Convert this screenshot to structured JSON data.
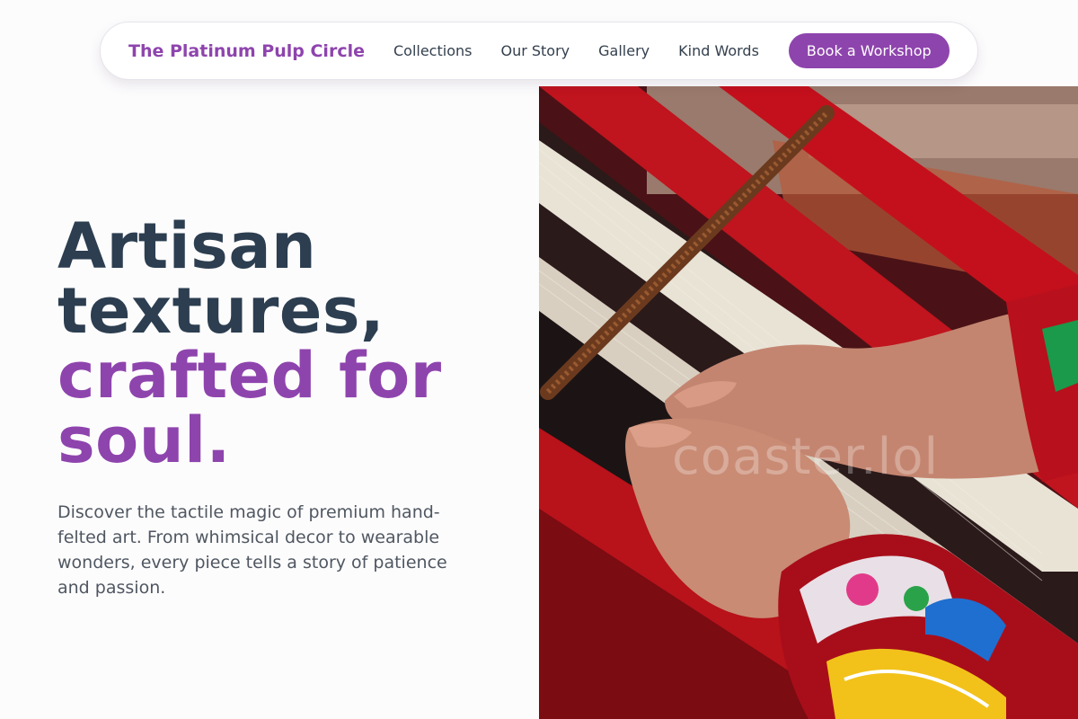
{
  "nav": {
    "brand": "The Platinum Pulp Circle",
    "links": [
      "Collections",
      "Our Story",
      "Gallery",
      "Kind Words"
    ],
    "cta": "Book a Workshop"
  },
  "hero": {
    "headline_line1": "Artisan",
    "headline_line2": "textures,",
    "headline_accent1": "crafted for",
    "headline_accent2": "soul.",
    "lead": "Discover the tactile magic of premium hand-felted art. From whimsical decor to wearable wonders, every piece tells a story of patience and passion."
  },
  "image": {
    "watermark": "coaster.lol",
    "subject": "hands weaving colorful threads on a loom"
  },
  "colors": {
    "accent": "#8e44ad",
    "heading": "#2c3e50"
  }
}
